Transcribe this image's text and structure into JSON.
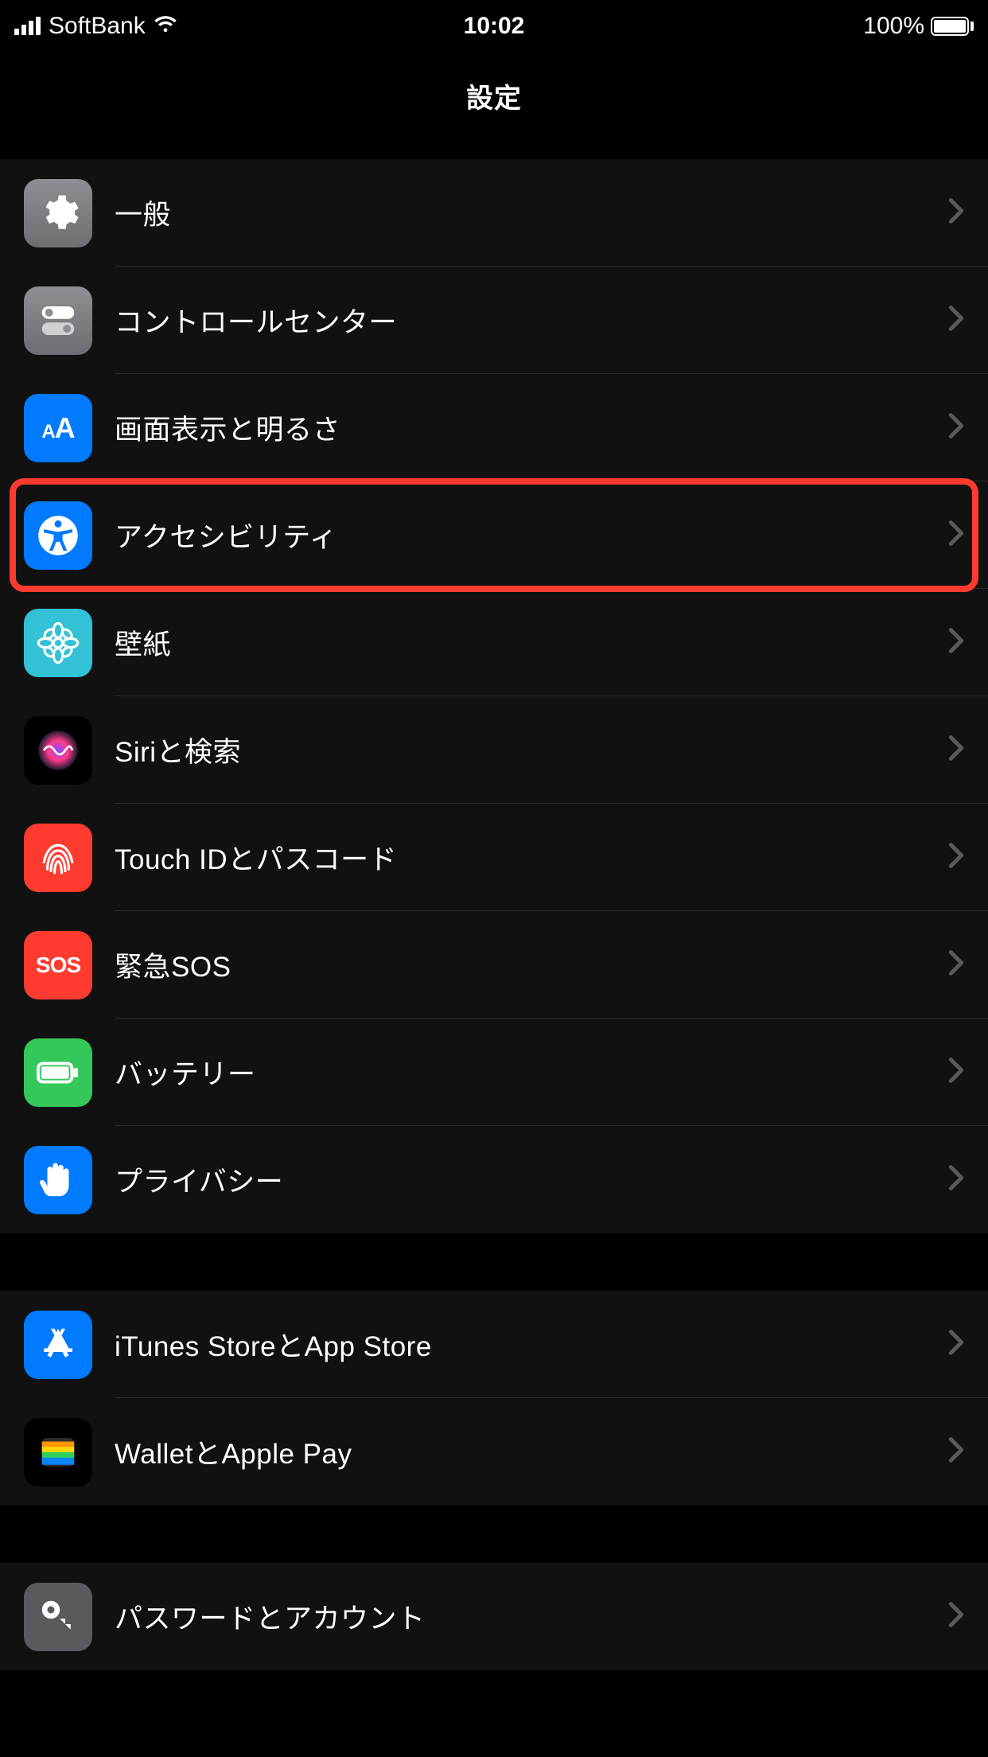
{
  "status": {
    "carrier": "SoftBank",
    "time": "10:02",
    "battery_pct": "100%"
  },
  "nav": {
    "title": "設定"
  },
  "sections": [
    {
      "rows": [
        {
          "id": "general",
          "label": "一般",
          "icon": "gear",
          "bg": "bg-gray"
        },
        {
          "id": "control-center",
          "label": "コントロールセンター",
          "icon": "switches",
          "bg": "bg-gray"
        },
        {
          "id": "display",
          "label": "画面表示と明るさ",
          "icon": "aa",
          "bg": "bg-blue"
        },
        {
          "id": "accessibility",
          "label": "アクセシビリティ",
          "icon": "accessibility",
          "bg": "bg-blue",
          "highlighted": true
        },
        {
          "id": "wallpaper",
          "label": "壁紙",
          "icon": "flower",
          "bg": "bg-cyan"
        },
        {
          "id": "siri",
          "label": "Siriと検索",
          "icon": "siri",
          "bg": "bg-black"
        },
        {
          "id": "touchid",
          "label": "Touch IDとパスコード",
          "icon": "fingerprint",
          "bg": "bg-red"
        },
        {
          "id": "sos",
          "label": "緊急SOS",
          "icon": "sos",
          "bg": "bg-red"
        },
        {
          "id": "battery",
          "label": "バッテリー",
          "icon": "battery",
          "bg": "bg-green"
        },
        {
          "id": "privacy",
          "label": "プライバシー",
          "icon": "hand",
          "bg": "bg-blue"
        }
      ]
    },
    {
      "rows": [
        {
          "id": "itunes",
          "label": "iTunes StoreとApp Store",
          "icon": "appstore",
          "bg": "bg-blue"
        },
        {
          "id": "wallet",
          "label": "WalletとApple Pay",
          "icon": "wallet",
          "bg": "bg-black"
        }
      ]
    },
    {
      "rows": [
        {
          "id": "passwords",
          "label": "パスワードとアカウント",
          "icon": "key",
          "bg": "bg-darkgray"
        }
      ]
    }
  ]
}
